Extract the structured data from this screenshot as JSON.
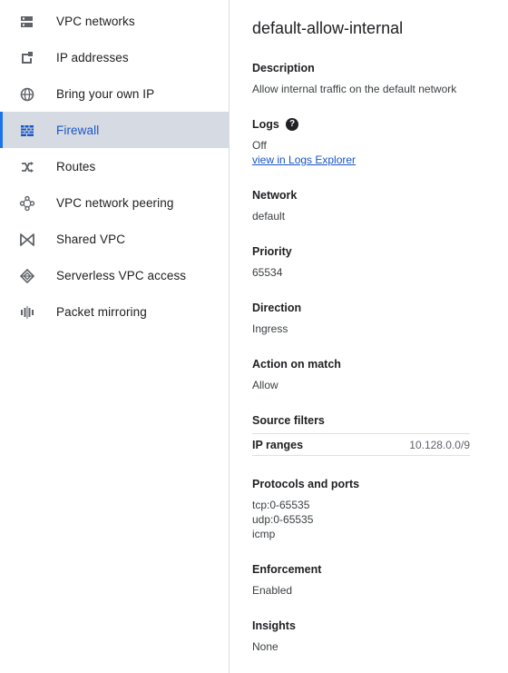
{
  "sidebar": {
    "items": [
      {
        "label": "VPC networks",
        "icon": "vpc-networks-icon"
      },
      {
        "label": "IP addresses",
        "icon": "ip-addresses-icon"
      },
      {
        "label": "Bring your own IP",
        "icon": "globe-icon"
      },
      {
        "label": "Firewall",
        "icon": "firewall-icon",
        "active": true
      },
      {
        "label": "Routes",
        "icon": "routes-icon"
      },
      {
        "label": "VPC network peering",
        "icon": "peering-icon"
      },
      {
        "label": "Shared VPC",
        "icon": "shared-vpc-icon"
      },
      {
        "label": "Serverless VPC access",
        "icon": "serverless-icon"
      },
      {
        "label": "Packet mirroring",
        "icon": "packet-mirroring-icon"
      }
    ],
    "accent_color": "#1a73e8",
    "active_bg": "#d6dbe3"
  },
  "detail": {
    "title": "default-allow-internal",
    "description": {
      "label": "Description",
      "value": "Allow internal traffic on the default network"
    },
    "logs": {
      "label": "Logs",
      "value": "Off",
      "link": "view in Logs Explorer",
      "help_icon": "help-icon"
    },
    "network": {
      "label": "Network",
      "value": "default"
    },
    "priority": {
      "label": "Priority",
      "value": "65534"
    },
    "direction": {
      "label": "Direction",
      "value": "Ingress"
    },
    "action": {
      "label": "Action on match",
      "value": "Allow"
    },
    "source_filters": {
      "label": "Source filters",
      "rows": [
        {
          "key": "IP ranges",
          "value": "10.128.0.0/9"
        }
      ]
    },
    "protocols": {
      "label": "Protocols and ports",
      "values": [
        "tcp:0-65535",
        "udp:0-65535",
        "icmp"
      ]
    },
    "enforcement": {
      "label": "Enforcement",
      "value": "Enabled"
    },
    "insights": {
      "label": "Insights",
      "value": "None"
    }
  }
}
